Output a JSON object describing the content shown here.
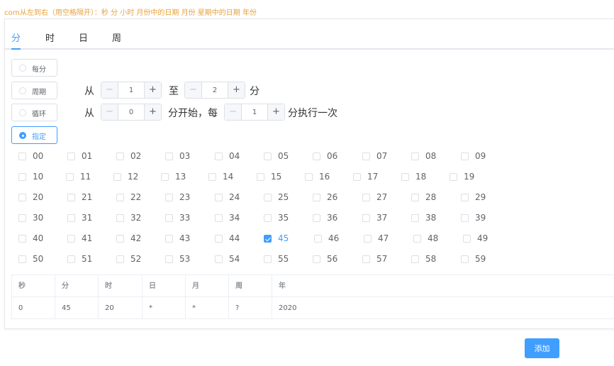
{
  "hint": "corn从左到右（用空格隔开）：秒 分 小时 月份中的日期 月份 星期中的日期 年份",
  "tabs": [
    {
      "label": "分",
      "active": true
    },
    {
      "label": "时",
      "active": false
    },
    {
      "label": "日",
      "active": false
    },
    {
      "label": "周",
      "active": false
    }
  ],
  "options": {
    "every": {
      "label": "每分",
      "checked": false
    },
    "period": {
      "label": "周期",
      "checked": false,
      "from_text": "从",
      "to_text": "至",
      "unit_text": "分",
      "from_value": "1",
      "to_value": "2"
    },
    "loop": {
      "label": "循环",
      "checked": false,
      "from_text": "从",
      "mid_text": "分开始，每",
      "end_text": "分执行一次",
      "start_value": "0",
      "step_value": "1"
    },
    "specify": {
      "label": "指定",
      "checked": true
    }
  },
  "stepper": {
    "minus": "−",
    "plus": "+"
  },
  "minutes": [
    "00",
    "01",
    "02",
    "03",
    "04",
    "05",
    "06",
    "07",
    "08",
    "09",
    "10",
    "11",
    "12",
    "13",
    "14",
    "15",
    "16",
    "17",
    "18",
    "19",
    "20",
    "21",
    "22",
    "23",
    "24",
    "25",
    "26",
    "27",
    "28",
    "29",
    "30",
    "31",
    "32",
    "33",
    "34",
    "35",
    "36",
    "37",
    "38",
    "39",
    "40",
    "41",
    "42",
    "43",
    "44",
    "45",
    "46",
    "47",
    "48",
    "49",
    "50",
    "51",
    "52",
    "53",
    "54",
    "55",
    "56",
    "57",
    "58",
    "59"
  ],
  "selected_minutes": [
    "45"
  ],
  "table": {
    "headers": [
      "秒",
      "分",
      "时",
      "日",
      "月",
      "周",
      "年"
    ],
    "row": [
      "0",
      "45",
      "20",
      "*",
      "*",
      "?",
      "2020"
    ]
  },
  "add_button": "添加",
  "colors": {
    "primary": "#409eff",
    "hint": "#e6a23c"
  }
}
